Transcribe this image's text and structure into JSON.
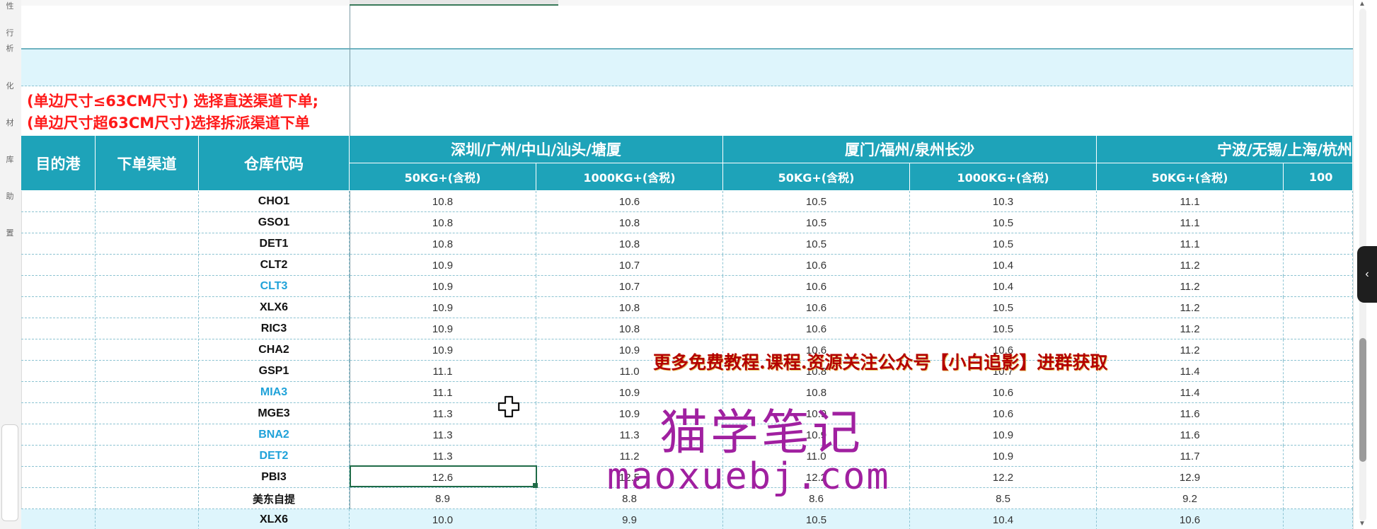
{
  "left_sidebar": {
    "items": [
      "性",
      "行",
      "析",
      "化",
      "材",
      "库",
      "助",
      "置"
    ]
  },
  "notes": {
    "line1": "(单边尺寸≤63CM尺寸) 选择直送渠道下单;",
    "line2": "(单边尺寸超63CM尺寸)选择拆派渠道下单"
  },
  "table": {
    "headers": {
      "port": "目的港",
      "channel": "下单渠道",
      "warehouse": "仓库代码",
      "group1": "深圳/广州/中山/汕头/塘厦",
      "group2": "厦门/福州/泉州长沙",
      "group3": "宁波/无锡/上海/杭州",
      "sub_50kg": "50KG+(含税)",
      "sub_1000kg": "1000KG+(含税)",
      "sub_1000kg_partial": "100"
    },
    "rows": [
      {
        "code": "CHO1",
        "v1": "10.8",
        "v2": "10.6",
        "v3": "10.5",
        "v4": "10.3",
        "v5": "11.1"
      },
      {
        "code": "GSO1",
        "v1": "10.8",
        "v2": "10.8",
        "v3": "10.5",
        "v4": "10.5",
        "v5": "11.1"
      },
      {
        "code": "DET1",
        "v1": "10.8",
        "v2": "10.8",
        "v3": "10.5",
        "v4": "10.5",
        "v5": "11.1"
      },
      {
        "code": "CLT2",
        "v1": "10.9",
        "v2": "10.7",
        "v3": "10.6",
        "v4": "10.4",
        "v5": "11.2"
      },
      {
        "code": "CLT3",
        "v1": "10.9",
        "v2": "10.7",
        "v3": "10.6",
        "v4": "10.4",
        "v5": "11.2"
      },
      {
        "code": "XLX6",
        "v1": "10.9",
        "v2": "10.8",
        "v3": "10.6",
        "v4": "10.5",
        "v5": "11.2"
      },
      {
        "code": "RIC3",
        "v1": "10.9",
        "v2": "10.8",
        "v3": "10.6",
        "v4": "10.5",
        "v5": "11.2"
      },
      {
        "code": "CHA2",
        "v1": "10.9",
        "v2": "10.9",
        "v3": "10.6",
        "v4": "10.6",
        "v5": "11.2"
      },
      {
        "code": "GSP1",
        "v1": "11.1",
        "v2": "11.0",
        "v3": "10.8",
        "v4": "10.7",
        "v5": "11.4"
      },
      {
        "code": "MIA3",
        "v1": "11.1",
        "v2": "10.9",
        "v3": "10.8",
        "v4": "10.6",
        "v5": "11.4"
      },
      {
        "code": "MGE3",
        "v1": "11.3",
        "v2": "10.9",
        "v3": "10.9",
        "v4": "10.6",
        "v5": "11.6"
      },
      {
        "code": "BNA2",
        "v1": "11.3",
        "v2": "11.3",
        "v3": "10.9",
        "v4": "10.9",
        "v5": "11.6"
      },
      {
        "code": "DET2",
        "v1": "11.3",
        "v2": "11.2",
        "v3": "11.0",
        "v4": "10.9",
        "v5": "11.7"
      },
      {
        "code": "PBI3",
        "v1": "12.6",
        "v2": "12.5",
        "v3": "12.2",
        "v4": "12.2",
        "v5": "12.9"
      },
      {
        "code": "美东自提",
        "v1": "8.9",
        "v2": "8.8",
        "v3": "8.6",
        "v4": "8.5",
        "v5": "9.2"
      },
      {
        "code": "XLX6",
        "v1": "10.0",
        "v2": "9.9",
        "v3": "10.5",
        "v4": "10.4",
        "v5": "10.6"
      }
    ]
  },
  "watermark": {
    "promo": "更多免费教程.课程.资源关注公众号【小白追影】进群获取",
    "brand": "猫学笔记",
    "url": "maoxuebj.com"
  },
  "colors": {
    "header_teal": "#1ea3b9",
    "band_light_blue": "#def5fc",
    "note_red": "#ff1a1a",
    "code_blue": "#1fa2d9",
    "watermark_purple": "#a020a0",
    "watermark_red": "#b40000"
  },
  "icons": {
    "cursor": "cross-move-cursor-icon",
    "collapse": "chevron-left-icon"
  }
}
